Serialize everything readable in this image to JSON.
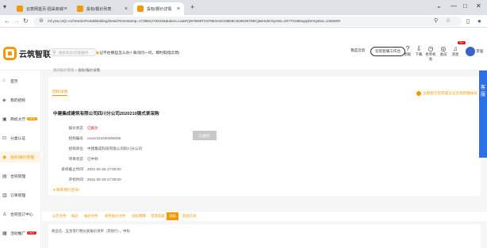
{
  "browser": {
    "tabs": [
      {
        "title": "云筑网首页-招采商城平台",
        "favicon_color": "#f39800",
        "active": false
      },
      {
        "title": "投标/报价列表",
        "favicon_color": "#f39800",
        "active": false
      },
      {
        "title": "投标/报价详情",
        "favicon_color": "#f39800",
        "active": true
      }
    ],
    "new_tab": "+",
    "url": "mf.yzw.cn/jc-v1/VendorPortal/Bidding/Detail?timestamp=1738912783225&token=UaMYjW7B08TC87964ASCD8EBC5290297D8Cj&tenderSysNo=20770168supplierSysNo=1492609",
    "win_controls": [
      "⌄",
      "—",
      "□",
      "✕"
    ]
  },
  "header": {
    "logo_text": "云筑智联",
    "search_placeholder": "搜索商品/店铺/服务",
    "quick_ask": "记不住哪些怎么办? 来问问一问，即时取得云筑!",
    "entries": [
      "我是云筑",
      "云筑智联工作台"
    ],
    "icons": [
      {
        "icon": "help-icon",
        "label": "帮助"
      },
      {
        "icon": "download-icon",
        "label": "下载"
      },
      {
        "icon": "clock-icon",
        "label": "抢单机会"
      },
      {
        "icon": "member-icon",
        "label": "会员"
      },
      {
        "icon": "bell-icon",
        "label": "消息"
      }
    ],
    "badge": "99+",
    "user": "李强"
  },
  "sidebar": {
    "items": [
      {
        "label": "首页",
        "icon": "home-icon",
        "active": false
      },
      {
        "label": "我的招标",
        "icon": "bid-icon",
        "active": false
      },
      {
        "label": "商机大厅",
        "icon": "hall-icon",
        "active": false,
        "tag": "NEW"
      },
      {
        "label": "分类认证",
        "icon": "cert-icon",
        "active": false
      },
      {
        "label": "投标/报价管理",
        "icon": "quote-icon",
        "active": true
      },
      {
        "label": "合同管理",
        "icon": "contract-icon",
        "active": false
      },
      {
        "label": "订单管理",
        "icon": "order-icon",
        "active": false
      },
      {
        "label": "合同签订中心",
        "icon": "sign-icon",
        "active": false
      },
      {
        "label": "活动推广",
        "icon": "promo-icon",
        "active": false,
        "tag_red": "HOT"
      }
    ]
  },
  "breadcrumb": {
    "path": "我的报价管理 > ",
    "current": "投标/报价详情"
  },
  "detail": {
    "tab": "招标详情",
    "notice": "立即提示您完成认证云筑智联帐号",
    "title": "中建集成建筑有限公司四川分公司2020210钢式录采购",
    "rows": [
      {
        "label": "报价状态",
        "value": "已报价",
        "red": true
      },
      {
        "label": "招标编号",
        "value": "cscecz21020260036"
      },
      {
        "label": "招标单位",
        "value": "中建集成科技有限公司四川分公司"
      },
      {
        "label": "项目状态",
        "value": "已中标"
      },
      {
        "label": "投标截止时间",
        "value": "2021-02-25 17:00:00"
      },
      {
        "label": "开标时间",
        "value": "2021-02-25 17:00:00"
      }
    ],
    "button": "已报价",
    "tip": "● 联系我们咨询!"
  },
  "tabs2": [
    "公告文件",
    "报名",
    "报价文件",
    "商务报价文件",
    "投标明细",
    "澄清答疑",
    "流标",
    "其他方式"
  ],
  "tabs2_active": 6,
  "footer_text": "商品名、五金等行物分类报价清单（其他行），中标",
  "right_strip": "客服"
}
